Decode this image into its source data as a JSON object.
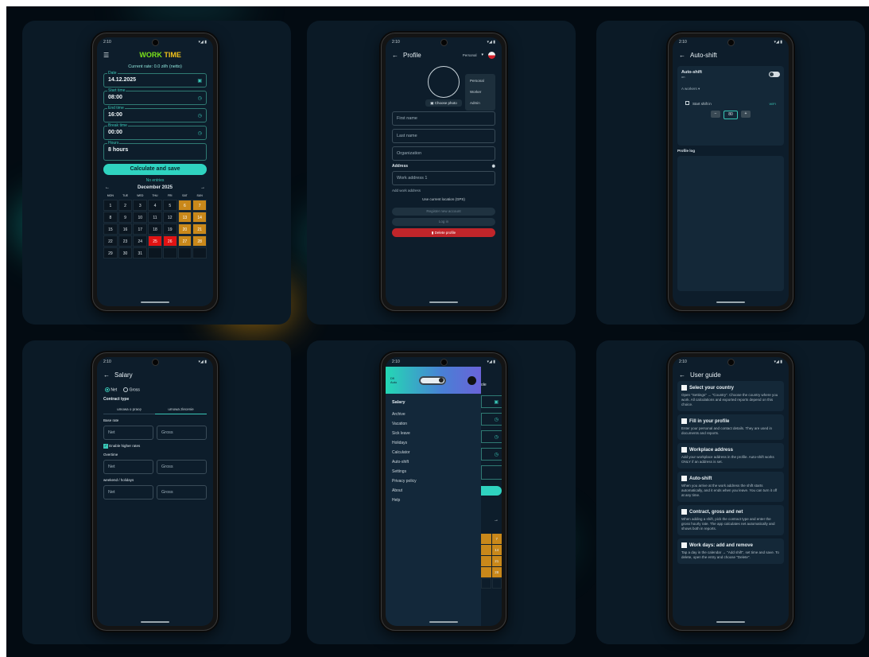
{
  "status_time": "2:10",
  "status_icons": "⚙ ⊙ ▪",
  "status_right": "▾◢ ▮",
  "phone1": {
    "title_a": "WORK",
    "title_b": "TIME",
    "rate": "Current rate: 0.0 zł/h (netto)",
    "date_label": "Date",
    "date_value": "14.12.2025",
    "start_label": "Start time",
    "start_value": "08:00",
    "end_label": "End time",
    "end_value": "16:00",
    "break_label": "Break time",
    "break_value": "00:00",
    "hours_label": "Hours",
    "hours_value": "8 hours",
    "calc_button": "Calculate and save",
    "no_entries": "No entries",
    "month": "December 2025",
    "weekdays": [
      "MON",
      "TUE",
      "WED",
      "THU",
      "FRI",
      "SAT",
      "SUN"
    ],
    "days": [
      "1",
      "2",
      "3",
      "4",
      "5",
      "6",
      "7",
      "8",
      "9",
      "10",
      "11",
      "12",
      "13",
      "14",
      "15",
      "16",
      "17",
      "18",
      "19",
      "20",
      "21",
      "22",
      "23",
      "24",
      "25",
      "26",
      "27",
      "28",
      "29",
      "30",
      "31"
    ]
  },
  "phone2": {
    "title": "Profile",
    "mode": "Personal",
    "menu": [
      "Personal",
      "Worker",
      "Admin"
    ],
    "photo_button": "Choose photo",
    "first_name": "First name",
    "last_name": "Last name",
    "organization": "Organization",
    "address_section": "Address",
    "work_address": "Work address 1",
    "add_address": "Add work address",
    "use_location": "Use current location (GPS)",
    "register": "Register new account",
    "login": "Log in",
    "delete": "Delete profile"
  },
  "phone3": {
    "title": "Auto-shift",
    "auto_label": "Auto-shift",
    "auto_sub": "on",
    "section": "A workers",
    "start_shift": "Start shift in",
    "start_value": "WIFI",
    "radius": "80",
    "log": "Profile log"
  },
  "phone4": {
    "title": "Salary",
    "net": "Net",
    "gross": "Gross",
    "contract_label": "Contract type",
    "contract_a": "umowa o pracę",
    "contract_b": "umowa zlecenie",
    "base_label": "Base rate",
    "field_net": "Net",
    "field_gross": "Gross",
    "higher_rates": "Enable higher rates",
    "overtime": "Overtime",
    "weekend": "weekend / holidays"
  },
  "phone5": {
    "header_top": "Dfl",
    "header_sub": "Auto",
    "section": "Salary",
    "items": [
      "Archive",
      "Vacation",
      "Sick leave",
      "Holidays",
      "Calculator",
      "Auto-shift",
      "Settings",
      "Privacy policy",
      "About",
      "Help"
    ],
    "behind_title": "ole",
    "behind_days": [
      "7",
      "14",
      "21",
      "28"
    ]
  },
  "phone6": {
    "title": "User guide",
    "cards": [
      {
        "title": "Select your country",
        "desc": "Open \"Settings\" → \"Country\". Choose the country where you work. All calculations and exported reports depend on this choice."
      },
      {
        "title": "Fill in your profile",
        "desc": "Enter your personal and contact details. They are used in documents and reports."
      },
      {
        "title": "Workplace address",
        "desc": "Add your workplace address in the profile. Auto-shift works ONLY if an address is set."
      },
      {
        "title": "Auto-shift",
        "desc": "When you arrive at the work address the shift starts automatically, and it ends when you leave. You can turn it off at any time."
      },
      {
        "title": "Contract, gross and net",
        "desc": "When adding a shift, pick the contract type and enter the gross hourly rate. The app calculates net automatically and shows both in reports."
      },
      {
        "title": "Work days: add and remove",
        "desc": "Tap a day in the calendar → \"Add shift\", set time and save. To delete, open the entry and choose \"Delete\"."
      }
    ]
  }
}
